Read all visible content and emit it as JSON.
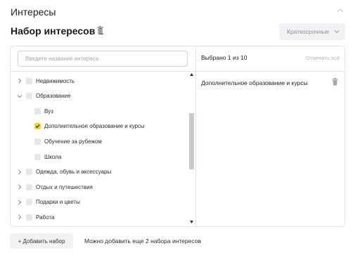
{
  "section": {
    "title": "Интересы"
  },
  "set": {
    "title": "Набор интересов 1",
    "period": "Краткосрочные"
  },
  "search": {
    "placeholder": "Введите название интереса"
  },
  "tree": [
    {
      "label": "Недвижимость",
      "level": 0,
      "expandable": true,
      "expanded": false,
      "checked": false
    },
    {
      "label": "Образование",
      "level": 0,
      "expandable": true,
      "expanded": true,
      "checked": false
    },
    {
      "label": "Вуз",
      "level": 1,
      "expandable": false,
      "checked": false
    },
    {
      "label": "Дополнительное образование и курсы",
      "level": 1,
      "expandable": false,
      "checked": true
    },
    {
      "label": "Обучение за рубежом",
      "level": 1,
      "expandable": false,
      "checked": false
    },
    {
      "label": "Школа",
      "level": 1,
      "expandable": false,
      "checked": false
    },
    {
      "label": "Одежда, обувь и аксессуары",
      "level": 0,
      "expandable": true,
      "expanded": false,
      "checked": false
    },
    {
      "label": "Отдых и путешествия",
      "level": 0,
      "expandable": true,
      "expanded": false,
      "checked": false
    },
    {
      "label": "Подарки и цветы",
      "level": 0,
      "expandable": true,
      "expanded": false,
      "checked": false
    },
    {
      "label": "Работа",
      "level": 0,
      "expandable": true,
      "expanded": false,
      "checked": false
    }
  ],
  "selection": {
    "count_text": "Выбрано 1 из 10",
    "clear_label": "Отменить всё",
    "items": [
      "Дополнительное образование и курсы"
    ]
  },
  "footer": {
    "add_button": "+ Добавить набор",
    "hint": "Можно добавить еще 2 набора интересов"
  },
  "colors": {
    "accent_checkbox": "#ffd21f",
    "panel_border": "#e3e4e7",
    "button_bg": "#f1f2f4"
  },
  "icons": {
    "collapse": "chevron-up-icon",
    "delete": "trash-icon",
    "dropdown": "chevron-down-icon",
    "expand": "chevron-right-icon",
    "check": "check-icon"
  }
}
